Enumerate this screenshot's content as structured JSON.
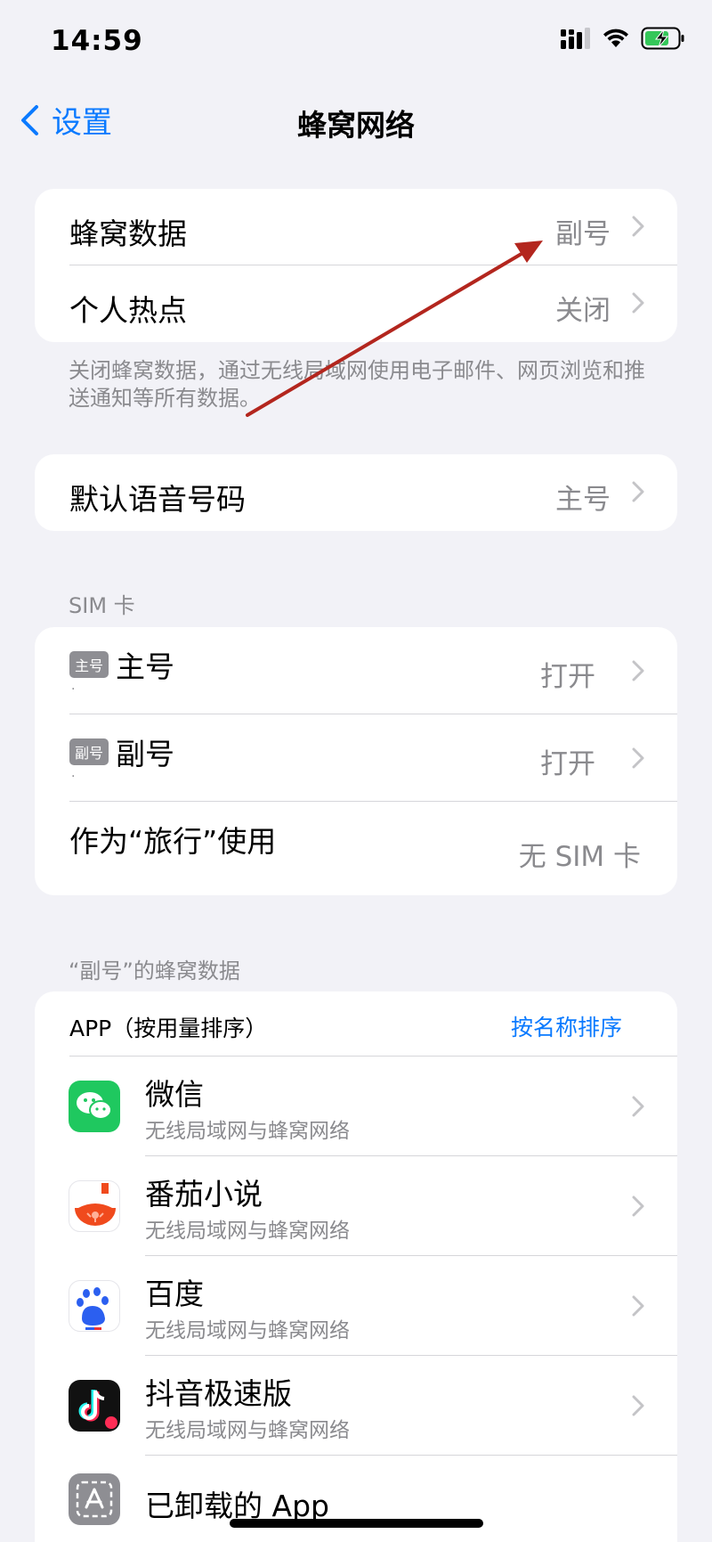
{
  "status": {
    "time": "14:59"
  },
  "nav": {
    "back_label": "设置",
    "title": "蜂窝网络"
  },
  "group1": {
    "rows": [
      {
        "title": "蜂窝数据",
        "value": "副号"
      },
      {
        "title": "个人热点",
        "value": "关闭"
      }
    ],
    "footnote": "关闭蜂窝数据，通过无线局域网使用电子邮件、网页浏览和推送通知等所有数据。"
  },
  "group2": {
    "title": "默认语音号码",
    "value": "主号"
  },
  "sim": {
    "header": "SIM 卡",
    "rows": [
      {
        "badge": "主号",
        "title": "主号",
        "sub": "·",
        "value": "打开"
      },
      {
        "badge": "副号",
        "title": "副号",
        "sub": "·",
        "value": "打开"
      }
    ],
    "travel": {
      "title": "作为“旅行”使用",
      "value": "无 SIM 卡"
    }
  },
  "apps": {
    "header": "“副号”的蜂窝数据",
    "list_label": "APP（按用量排序）",
    "sort_link": "按名称排序",
    "items": [
      {
        "name": "微信",
        "sub": "无线局域网与蜂窝网络",
        "icon": "wechat-icon"
      },
      {
        "name": "番茄小说",
        "sub": "无线局域网与蜂窝网络",
        "icon": "fanqie-icon"
      },
      {
        "name": "百度",
        "sub": "无线局域网与蜂窝网络",
        "icon": "baidu-icon"
      },
      {
        "name": "抖音极速版",
        "sub": "无线局域网与蜂窝网络",
        "icon": "douyin-icon"
      },
      {
        "name": "已卸载的 App",
        "sub": "",
        "icon": "uninstalled-app-icon"
      }
    ]
  },
  "colors": {
    "accent": "#0a7aff",
    "background": "#f2f2f7",
    "secondary_text": "#8a8a8e",
    "annotation_arrow": "#b3261e"
  }
}
